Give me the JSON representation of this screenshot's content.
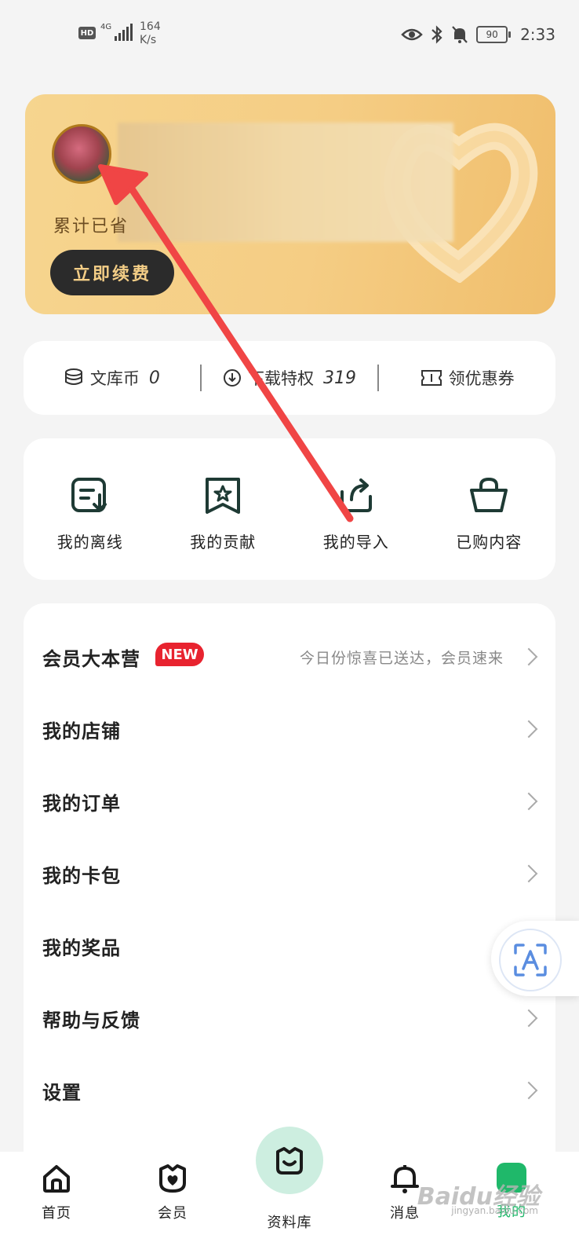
{
  "status_bar": {
    "hd": "HD",
    "network": "4G",
    "speed_value": "164",
    "speed_unit": "K/s",
    "battery": "90",
    "time": "2:33"
  },
  "member_card": {
    "saved_label": "累计已省",
    "renew_button": "立即续费"
  },
  "assets": {
    "coins_label": "文库币",
    "coins_value": "0",
    "download_label": "下载特权",
    "download_value": "319",
    "coupon_label": "领优惠券"
  },
  "quick_actions": [
    {
      "label": "我的离线",
      "icon": "offline-download-icon"
    },
    {
      "label": "我的贡献",
      "icon": "contribution-star-icon"
    },
    {
      "label": "我的导入",
      "icon": "import-share-icon"
    },
    {
      "label": "已购内容",
      "icon": "shopping-bag-icon"
    }
  ],
  "menu": {
    "items": [
      {
        "label": "会员大本营",
        "badge": "NEW",
        "subtitle": "今日份惊喜已送达，会员速来"
      },
      {
        "label": "我的店铺"
      },
      {
        "label": "我的订单"
      },
      {
        "label": "我的卡包"
      },
      {
        "label": "我的奖品"
      },
      {
        "label": "帮助与反馈"
      },
      {
        "label": "设置"
      }
    ]
  },
  "tabbar": {
    "tabs": [
      {
        "label": "首页",
        "icon": "home-icon"
      },
      {
        "label": "会员",
        "icon": "member-heart-icon"
      },
      {
        "label": "资料库",
        "icon": "library-icon"
      },
      {
        "label": "消息",
        "icon": "bell-icon"
      },
      {
        "label": "我的",
        "icon": "profile-icon"
      }
    ],
    "active_color": "#1fb86a"
  },
  "colors": {
    "card_gold": "#f5cd84",
    "renew_bg": "#2b2b2b",
    "renew_text": "#f3cd86",
    "badge_red": "#e8232f",
    "annotation_arrow": "#f04545"
  },
  "watermark": {
    "brand": "Baidu经验",
    "site": "jingyan.baidu.com"
  }
}
